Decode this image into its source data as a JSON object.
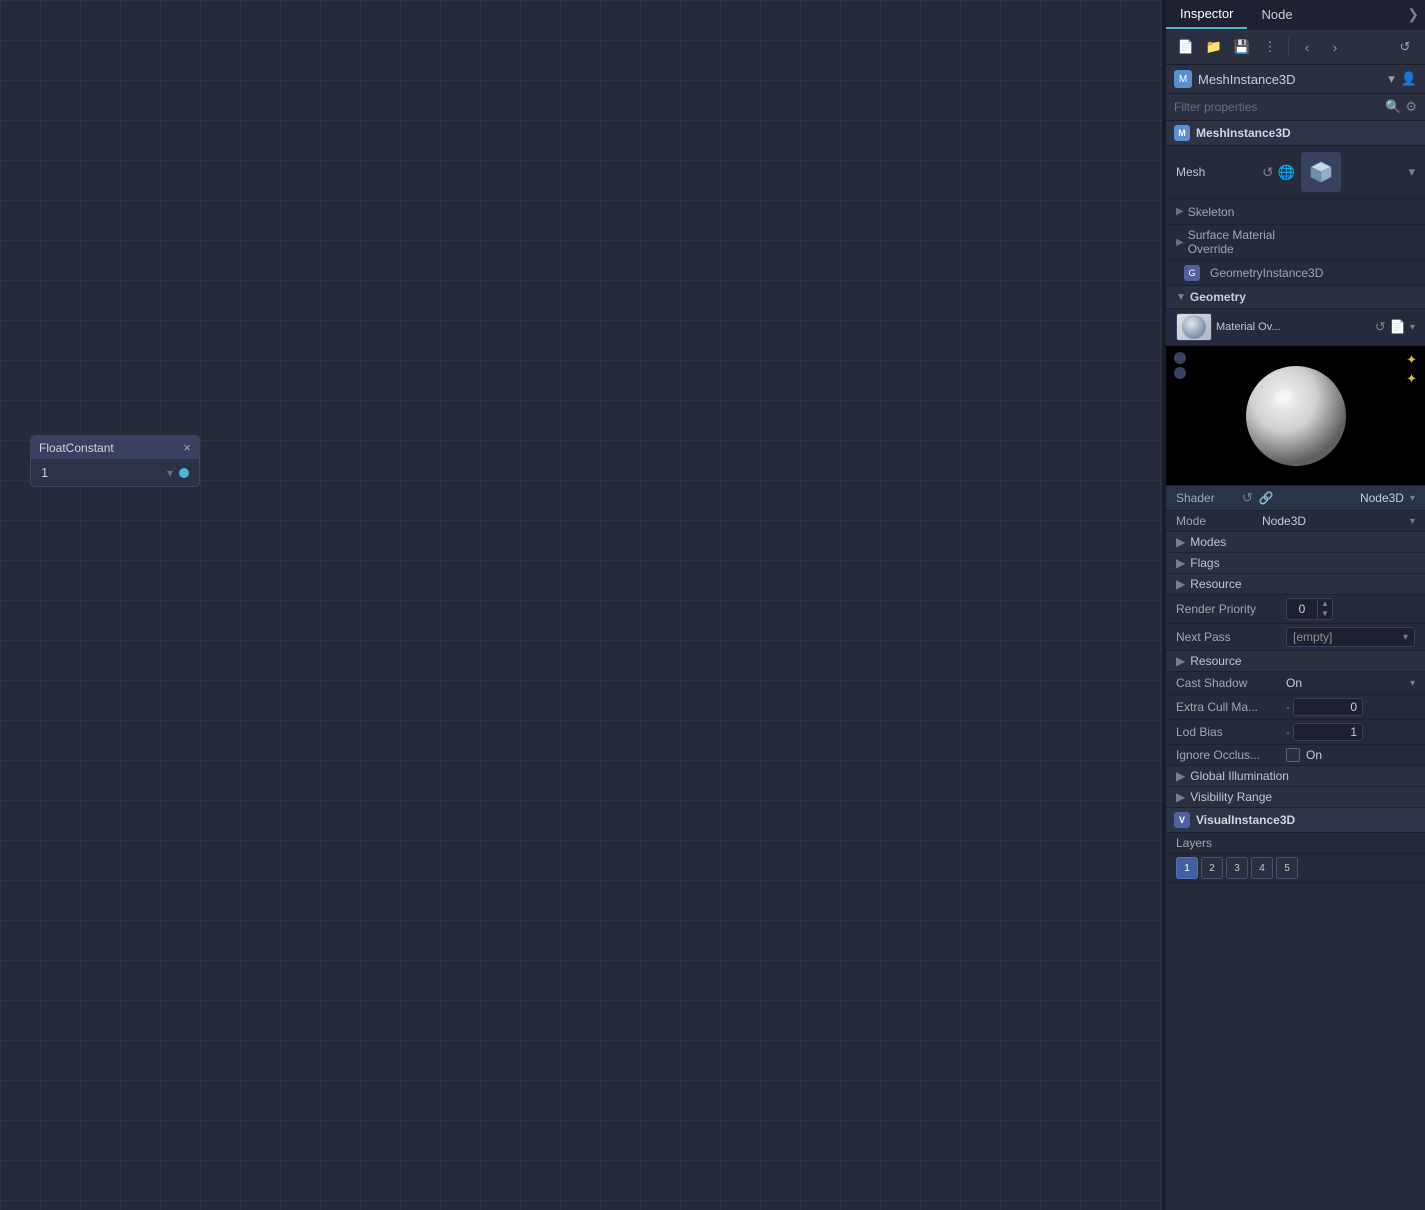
{
  "canvas": {
    "float_node": {
      "title": "FloatConstant",
      "value": "1",
      "close_label": "×"
    }
  },
  "inspector": {
    "tabs": [
      {
        "label": "Inspector",
        "active": true
      },
      {
        "label": "Node",
        "active": false
      }
    ],
    "toolbar": {
      "icons": [
        "📄",
        "📁",
        "💾",
        "⋮",
        "‹",
        "›",
        "↺"
      ]
    },
    "component_type": "MeshInstance3D",
    "filter_placeholder": "Filter properties",
    "section_title": "MeshInstance3D",
    "mesh_label": "Mesh",
    "skeleton_label": "Skeleton",
    "surface_material_override_label": "Surface Material Override",
    "geometry_instance_3d_label": "GeometryInstance3D",
    "geometry_label": "Geometry",
    "material_label": "Material Ov...",
    "shader_label": "Shader",
    "shader_value": "Node3D",
    "mode_label": "Mode",
    "mode_value": "Node3D",
    "modes_label": "Modes",
    "flags_label": "Flags",
    "resource_label": "Resource",
    "render_priority_label": "Render Priority",
    "render_priority_value": "0",
    "next_pass_label": "Next Pass",
    "next_pass_value": "[empty]",
    "resource2_label": "Resource",
    "cast_shadow_label": "Cast Shadow",
    "cast_shadow_value": "On",
    "extra_cull_label": "Extra Cull Ma...",
    "extra_cull_value": "0",
    "lod_bias_label": "Lod Bias",
    "lod_bias_value": "1",
    "ignore_occlus_label": "Ignore Occlus...",
    "ignore_occlus_value": "On",
    "global_illumination_label": "Global Illumination",
    "visibility_range_label": "Visibility Range",
    "visual_instance_label": "VisualInstance3D",
    "layers_label": "Layers",
    "layer_buttons": [
      "1",
      "2",
      "3",
      "4",
      "5"
    ]
  }
}
